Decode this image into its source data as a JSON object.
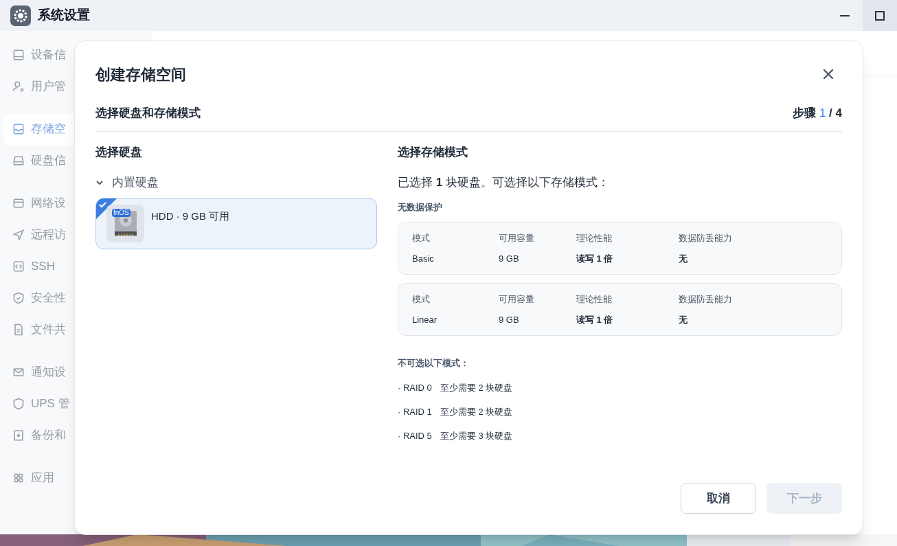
{
  "window": {
    "title": "系统设置"
  },
  "sidebar": {
    "groups": [
      [
        {
          "label": "设备信",
          "selected": false
        },
        {
          "label": "用户管",
          "selected": false
        }
      ],
      [
        {
          "label": "存储空",
          "selected": true
        },
        {
          "label": "硬盘信",
          "selected": false
        }
      ],
      [
        {
          "label": "网络设",
          "selected": false
        },
        {
          "label": "远程访",
          "selected": false
        },
        {
          "label": "SSH",
          "selected": false
        },
        {
          "label": "安全性",
          "selected": false
        },
        {
          "label": "文件共",
          "selected": false
        }
      ],
      [
        {
          "label": "通知设",
          "selected": false
        },
        {
          "label": "UPS 管",
          "selected": false
        },
        {
          "label": "备份和",
          "selected": false
        }
      ],
      [
        {
          "label": "应用",
          "selected": false
        }
      ]
    ]
  },
  "dialog": {
    "title": "创建存储空间",
    "subtitle": "选择硬盘和存储模式",
    "step": {
      "label": "步骤",
      "current": "1",
      "total": "/ 4"
    },
    "disks": {
      "heading": "选择硬盘",
      "group": {
        "label": "内置硬盘",
        "expanded": true
      },
      "items": [
        {
          "label": "HDD · 9 GB 可用",
          "badge": "fnOS",
          "checked": true
        }
      ]
    },
    "modes": {
      "heading": "选择存储模式",
      "summary": "已选择 **1** 块硬盘。可选择以下存储模式：",
      "section": "无数据保护",
      "cards": [
        {
          "fields": [
            {
              "label": "模式",
              "value": "Basic"
            },
            {
              "label": "可用容量",
              "value": "9 GB"
            },
            {
              "label": "理论性能",
              "value": "读写 1 倍"
            },
            {
              "label": "数据防丢能力",
              "value": "无"
            }
          ]
        },
        {
          "fields": [
            {
              "label": "模式",
              "value": "Linear"
            },
            {
              "label": "可用容量",
              "value": "9 GB"
            },
            {
              "label": "理论性能",
              "value": "读写 1 倍"
            },
            {
              "label": "数据防丢能力",
              "value": "无"
            }
          ]
        }
      ],
      "unavailable_heading": "不可选以下模式：",
      "unavailable": [
        {
          "name": "· RAID 0",
          "requirement": "至少需要 2 块硬盘"
        },
        {
          "name": "· RAID 1",
          "requirement": "至少需要 2 块硬盘"
        },
        {
          "name": "· RAID 5",
          "requirement": "至少需要 3 块硬盘"
        }
      ]
    },
    "buttons": [
      {
        "label": "取消",
        "kind": "secondary",
        "disabled": false
      },
      {
        "label": "下一步",
        "kind": "primary",
        "disabled": true
      }
    ]
  }
}
